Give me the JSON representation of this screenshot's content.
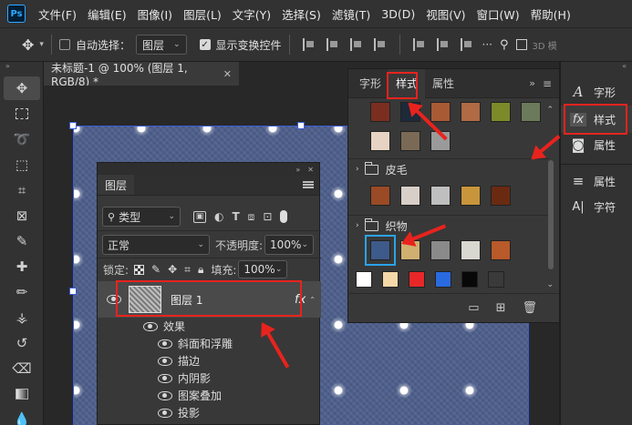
{
  "app": {
    "logo": "Ps"
  },
  "menu": [
    "文件(F)",
    "编辑(E)",
    "图像(I)",
    "图层(L)",
    "文字(Y)",
    "选择(S)",
    "滤镜(T)",
    "3D(D)",
    "视图(V)",
    "窗口(W)",
    "帮助(H)"
  ],
  "options": {
    "auto_select_label": "自动选择：",
    "auto_select_value": "图层",
    "show_transform_label": "显示变换控件",
    "mode_3d": "3D 模"
  },
  "document": {
    "tab_title": "未标题-1 @ 100% (图层 1, RGB/8) *"
  },
  "layers_panel": {
    "tab": "图层",
    "filter_kind": "类型",
    "blend_mode": "正常",
    "opacity_label": "不透明度:",
    "opacity_value": "100%",
    "lock_label": "锁定:",
    "fill_label": "填充:",
    "fill_value": "100%",
    "layer_name": "图层 1",
    "fx": "fx",
    "effects_label": "效果",
    "effects": [
      "斜面和浮雕",
      "描边",
      "内阴影",
      "图案叠加",
      "投影"
    ]
  },
  "styles_panel": {
    "tabs": [
      "字形",
      "样式",
      "属性"
    ],
    "groups": [
      {
        "name": "皮毛"
      },
      {
        "name": "织物"
      }
    ],
    "colors": {
      "top_row": [
        "#7a2e20",
        "#1c2a3a",
        "#a85a35",
        "#b06a45",
        "#7d8a2a",
        "#6a7a5a"
      ],
      "row2": [
        "#e6d3c3",
        "#7a6a55",
        "#9a9a9a"
      ],
      "fur": [
        "#9a4a25",
        "#d8cfc8",
        "#bfbfbf",
        "#c8953c",
        "#6a2a12"
      ],
      "fabric": [
        "#3e5a8a",
        "#d0b070",
        "#8a8a8a",
        "#d8d8d0",
        "#b85a2a"
      ],
      "basic": [
        "#ffffff",
        "#f5d8a8",
        "#e82828",
        "#2a6ae0",
        "#080808",
        "#3a3a3a"
      ]
    }
  },
  "dock": {
    "items": [
      {
        "icon": "A",
        "label": "字形"
      },
      {
        "icon": "fx",
        "label": "样式"
      },
      {
        "icon": "◙",
        "label": "属性"
      },
      {
        "icon": "≡",
        "label": "属性"
      },
      {
        "icon": "A|",
        "label": "字符"
      }
    ]
  },
  "annotation_color": "#e8231d"
}
